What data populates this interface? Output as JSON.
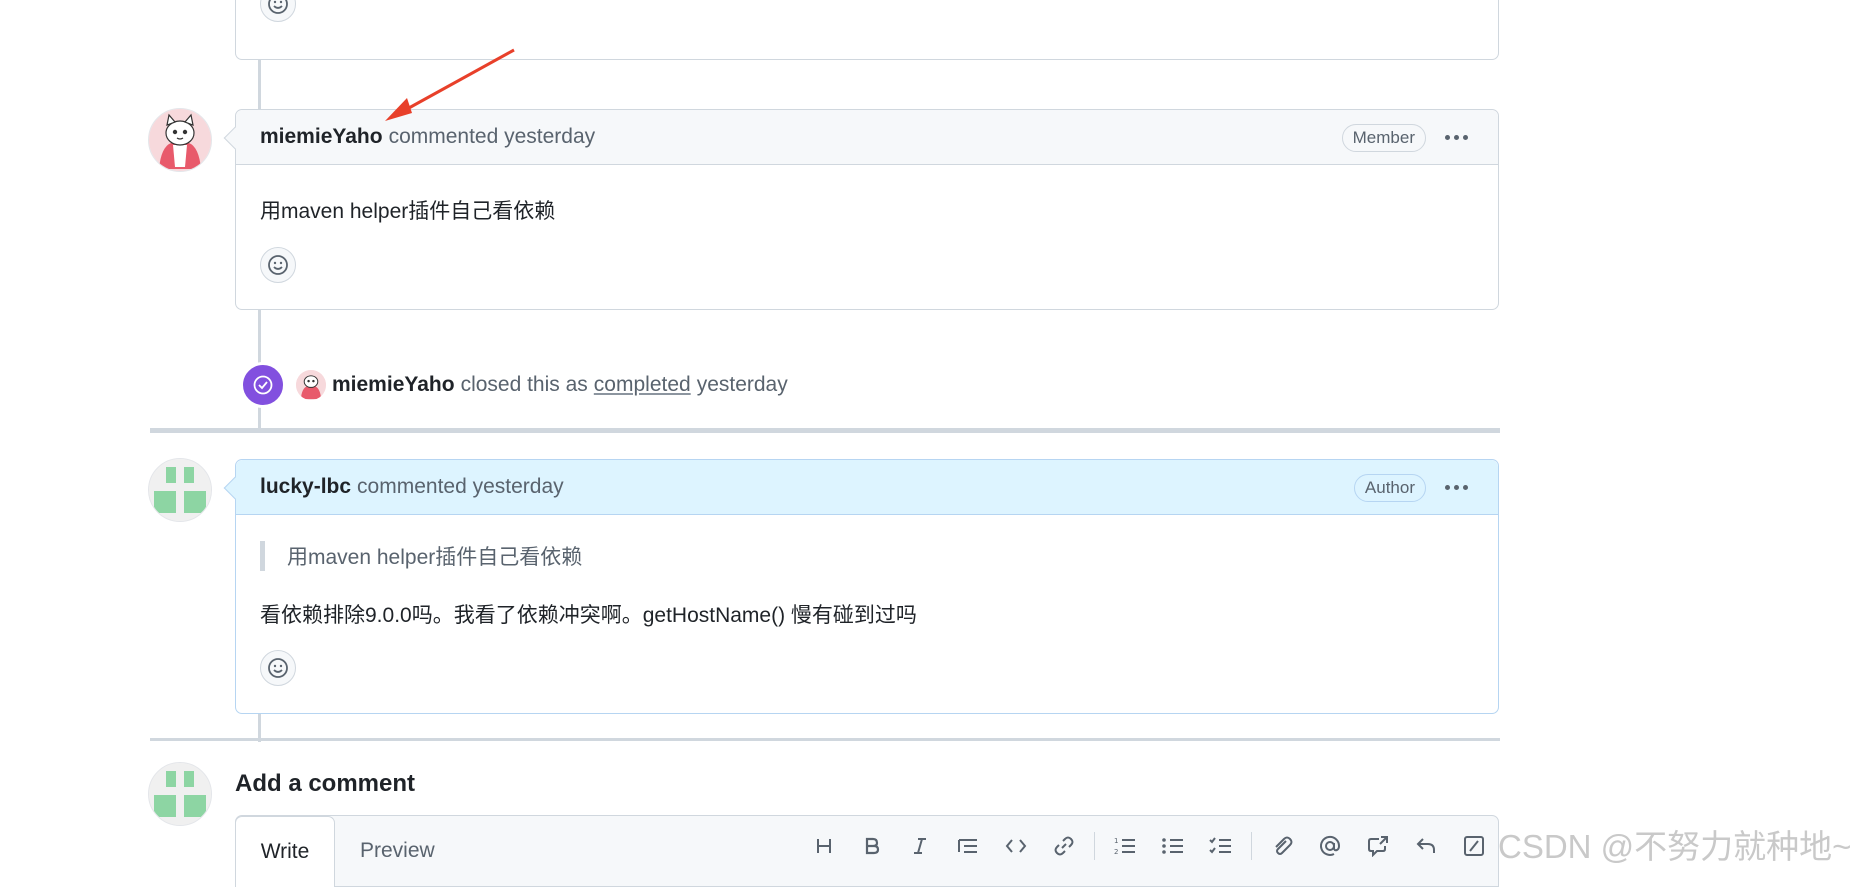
{
  "comments": [
    {
      "user": "miemieYaho",
      "meta": "commented yesterday",
      "badge": "Member",
      "body": "用maven helper插件自己看依赖"
    },
    {
      "user": "lucky-lbc",
      "meta": "commented yesterday",
      "badge": "Author",
      "quote": "用maven helper插件自己看依赖",
      "body": "看依赖排除9.0.0吗。我看了依赖冲突啊。getHostName() 慢有碰到过吗"
    }
  ],
  "event": {
    "user": "miemieYaho",
    "text": "closed this as",
    "link": "completed",
    "time": "yesterday"
  },
  "add_comment": {
    "title": "Add a comment",
    "tabs": [
      "Write",
      "Preview"
    ],
    "toolbar_icons": [
      "heading-icon",
      "bold-icon",
      "italic-icon",
      "quote-icon",
      "code-icon",
      "link-icon",
      "ordered-list-icon",
      "unordered-list-icon",
      "task-list-icon",
      "attach-icon",
      "mention-icon",
      "cross-reference-icon",
      "reply-icon",
      "slash-command-icon"
    ]
  },
  "watermark": "CSDN @不努力就种地~",
  "colors": {
    "closed_purple": "#8250df",
    "annotation_red": "#e8402a",
    "author_bg": "#ddf4ff"
  }
}
